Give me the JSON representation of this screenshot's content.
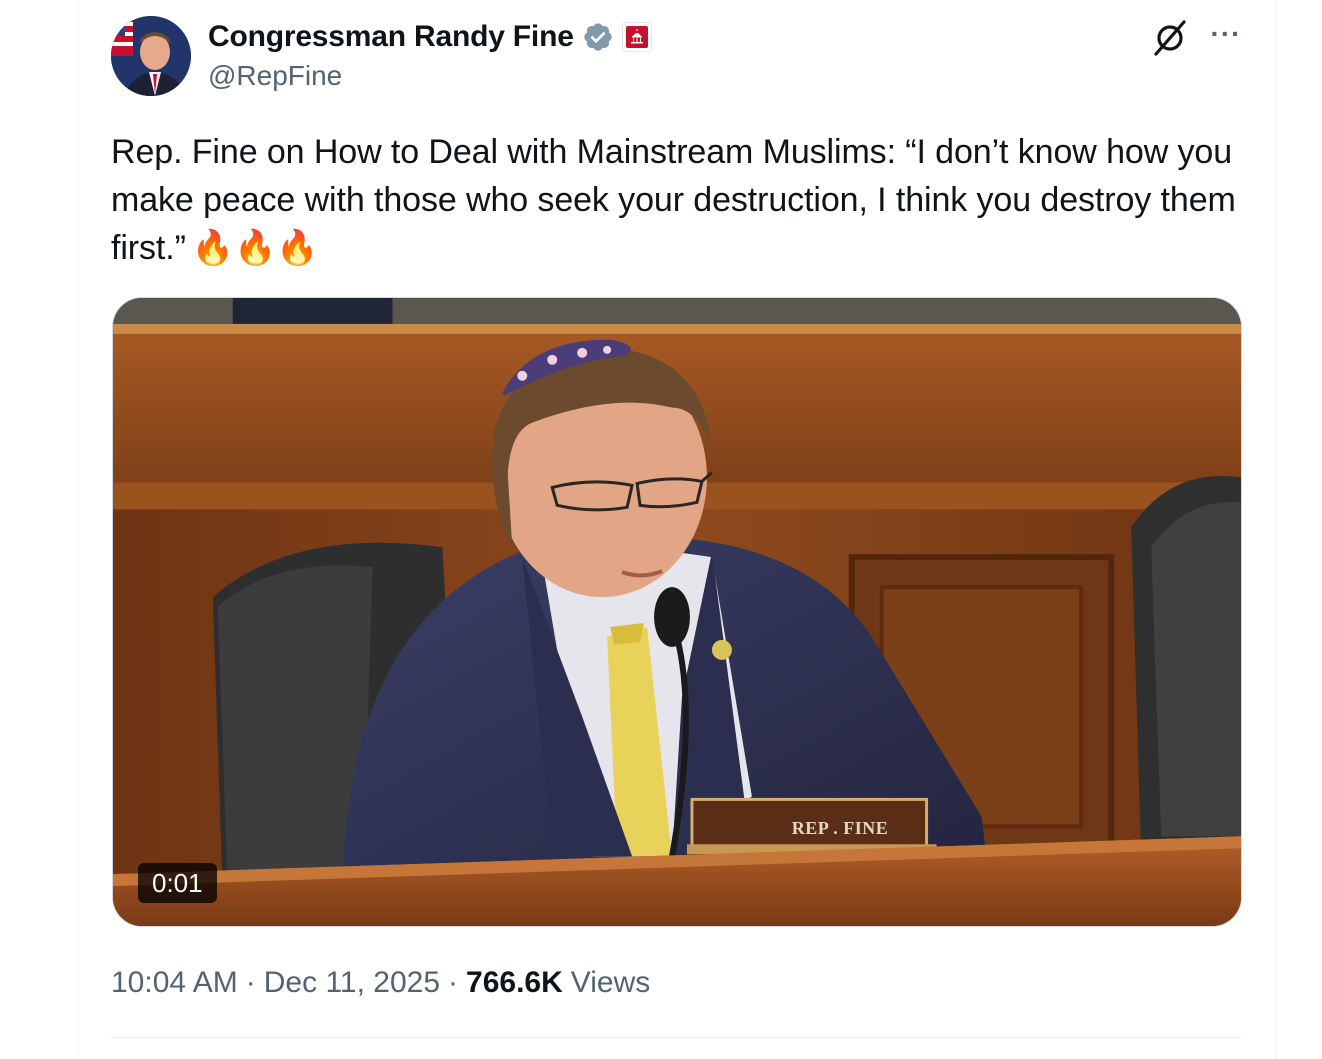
{
  "author": {
    "display_name": "Congressman Randy Fine",
    "handle": "@RepFine",
    "verified": true,
    "affiliation_badge": "government-capitol-icon"
  },
  "tweet": {
    "text": "Rep. Fine on How to Deal with Mainstream Muslims: “I don’t know how you make peace with those who seek your destruction, I think you destroy them first.”",
    "emoji": "🔥🔥🔥"
  },
  "media": {
    "type": "video",
    "duration": "0:01",
    "nameplate": "REP . FINE"
  },
  "meta": {
    "time": "10:04 AM",
    "separator": "·",
    "date": "Dec 11, 2025",
    "views_count": "766.6K",
    "views_label": "Views"
  },
  "icons": {
    "grok": "grok-icon",
    "more": "more-options-icon"
  },
  "colors": {
    "verified_blue": "#829aab",
    "gov_badge_red": "#c8102e",
    "secondary_text": "#536471",
    "primary_text": "#0f1419"
  }
}
